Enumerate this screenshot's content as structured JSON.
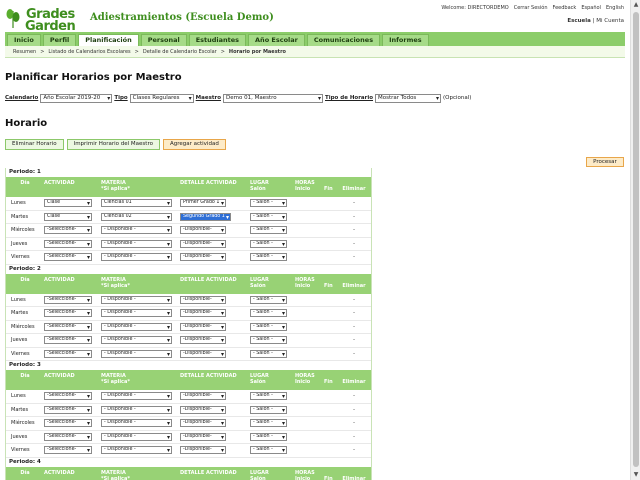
{
  "logo": {
    "line1": "Grades",
    "line2": "Garden"
  },
  "app_title": "Adiestramientos (Escuela Demo)",
  "top_links": [
    "Welcome: DIRECTORDEMO",
    "Cerrar Sesión",
    "Feedback",
    "Español",
    "English"
  ],
  "school_line": {
    "bold": "Escuela",
    "sep": " | ",
    "link": "Mi Cuenta"
  },
  "nav": {
    "tabs": [
      "Inicio",
      "Perfil",
      "Planificación",
      "Personal",
      "Estudiantes",
      "Año Escolar",
      "Comunicaciones",
      "Informes"
    ],
    "active": "Planificación"
  },
  "breadcrumb": [
    "Resumen",
    ">",
    "Listado de Calendarios Escolares",
    ">",
    "Detalle de Calendario Escolar",
    ">",
    "Horario por Maestro"
  ],
  "page_title": "Planificar Horarios por Maestro",
  "filters": {
    "calendario_label": "Calendario",
    "calendario_value": "Año Escolar 2019-20",
    "tipo_label": "Tipo",
    "tipo_value": "Clases Regulares",
    "maestro_label": "Maestro",
    "maestro_value": "Demo 01, Maestro",
    "tipo_horario_label": "Tipo de Horario",
    "tipo_horario_value": "Mostrar Todos",
    "opcional": "(Opcional)"
  },
  "section_title": "Horario",
  "actions": {
    "eliminar": "Eliminar Horario",
    "imprimir": "Imprimir Horario del Maestro",
    "agregar": "Agregar actividad"
  },
  "procesar": "Procesar",
  "grid_headers": {
    "dia": "Día",
    "actividad": "ACTIVIDAD",
    "materia": "MATERIA",
    "materia_sub": "*Si aplica*",
    "detalle": "DETALLE ACTIVIDAD",
    "lugar": "LUGAR",
    "salon": "Salón",
    "horas": "HORAS",
    "inicio": "Inicio",
    "fin": "Fin",
    "eliminar": "Eliminar"
  },
  "periods": [
    {
      "title": "Periodo: 1",
      "rows": [
        {
          "dia": "Lunes",
          "actividad": "Clase",
          "materia": "Ciencias 01",
          "detalle": "Primer Grado 1",
          "lugar": "- Salón -",
          "eliminar": "-"
        },
        {
          "dia": "Martes",
          "actividad": "Clase",
          "materia": "Ciencias 02",
          "detalle": "Segundo Grado 1",
          "lugar": "- Salón -",
          "eliminar": "-"
        },
        {
          "dia": "Miércoles",
          "actividad": "-Seleccione-",
          "materia": "- Disponible -",
          "detalle": "-Disponible-",
          "lugar": "- Salón -",
          "eliminar": "-"
        },
        {
          "dia": "Jueves",
          "actividad": "-Seleccione-",
          "materia": "- Disponible -",
          "detalle": "-Disponible-",
          "lugar": "- Salón -",
          "eliminar": "-"
        },
        {
          "dia": "Viernes",
          "actividad": "-Seleccione-",
          "materia": "- Disponible -",
          "detalle": "-Disponible-",
          "lugar": "- Salón -",
          "eliminar": "-"
        }
      ]
    },
    {
      "title": "Periodo: 2",
      "rows": [
        {
          "dia": "Lunes",
          "actividad": "-Seleccione-",
          "materia": "- Disponible -",
          "detalle": "-Disponible-",
          "lugar": "- Salón -",
          "eliminar": "-"
        },
        {
          "dia": "Martes",
          "actividad": "-Seleccione-",
          "materia": "- Disponible -",
          "detalle": "-Disponible-",
          "lugar": "- Salón -",
          "eliminar": "-"
        },
        {
          "dia": "Miércoles",
          "actividad": "-Seleccione-",
          "materia": "- Disponible -",
          "detalle": "-Disponible-",
          "lugar": "- Salón -",
          "eliminar": "-"
        },
        {
          "dia": "Jueves",
          "actividad": "-Seleccione-",
          "materia": "- Disponible -",
          "detalle": "-Disponible-",
          "lugar": "- Salón -",
          "eliminar": "-"
        },
        {
          "dia": "Viernes",
          "actividad": "-Seleccione-",
          "materia": "- Disponible -",
          "detalle": "-Disponible-",
          "lugar": "- Salón -",
          "eliminar": "-"
        }
      ]
    },
    {
      "title": "Periodo: 3",
      "rows": [
        {
          "dia": "Lunes",
          "actividad": "-Seleccione-",
          "materia": "- Disponible -",
          "detalle": "-Disponible-",
          "lugar": "- Salón -",
          "eliminar": "-"
        },
        {
          "dia": "Martes",
          "actividad": "-Seleccione-",
          "materia": "- Disponible -",
          "detalle": "-Disponible-",
          "lugar": "- Salón -",
          "eliminar": "-"
        },
        {
          "dia": "Miércoles",
          "actividad": "-Seleccione-",
          "materia": "- Disponible -",
          "detalle": "-Disponible-",
          "lugar": "- Salón -",
          "eliminar": "-"
        },
        {
          "dia": "Jueves",
          "actividad": "-Seleccione-",
          "materia": "- Disponible -",
          "detalle": "-Disponible-",
          "lugar": "- Salón -",
          "eliminar": "-"
        },
        {
          "dia": "Viernes",
          "actividad": "-Seleccione-",
          "materia": "- Disponible -",
          "detalle": "-Disponible-",
          "lugar": "- Salón -",
          "eliminar": "-"
        }
      ]
    },
    {
      "title": "Periodo: 4",
      "rows": []
    }
  ],
  "colors": {
    "brand_green": "#3e8e1e",
    "nav_green": "#8ccd6a",
    "header_green": "#98d275",
    "accent_orange": "#e8a64a",
    "highlight_blue": "#2f6fd6"
  },
  "icons": {
    "scroll_up": "▲",
    "scroll_down": "▼"
  }
}
